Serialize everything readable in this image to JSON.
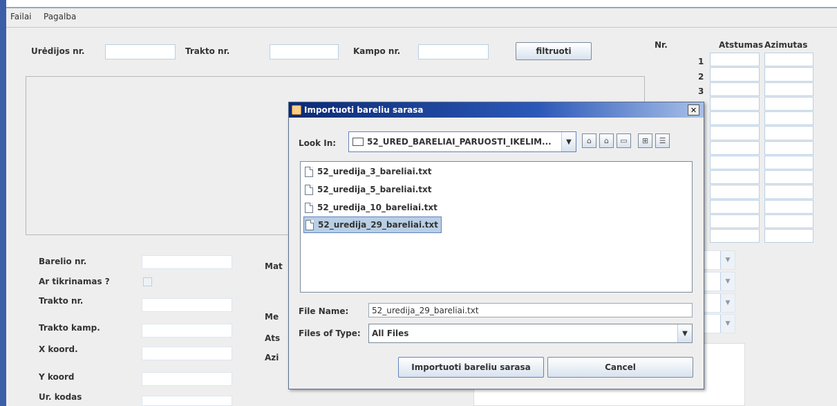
{
  "menu": {
    "items": [
      "Failai",
      "Pagalba"
    ]
  },
  "filter": {
    "uredija_label": "Urėdijos nr.",
    "trakto_label": "Trakto nr.",
    "kampo_label": "Kampo nr.",
    "button": "filtruoti"
  },
  "coords_table": {
    "nr_header": "Nr.",
    "atstumas_header": "Atstumas",
    "azimutas_header": "Azimutas",
    "row_numbers": [
      "1",
      "2",
      "3"
    ]
  },
  "form": {
    "barelio_label": "Barelio nr.",
    "tikrinamas_label": "Ar tikrinamas ?",
    "trakto_label": "Trakto nr.",
    "trakto_kamp_label": "Trakto kamp.",
    "x_label": "X koord.",
    "y_label": "Y koord",
    "ur_kodas_label": "Ur. kodas",
    "mid_label_1": "Mat",
    "mid_label_2": "Me",
    "mid_label_3": "Ats",
    "mid_label_4": "Azi"
  },
  "dialog": {
    "title": "Importuoti bareliu sarasa",
    "look_in_label": "Look In:",
    "look_in_value": "52_URED_BARELIAI_PARUOSTI_IKELIM...",
    "files": [
      "52_uredija_3_bareliai.txt",
      "52_uredija_5_bareliai.txt",
      "52_uredija_10_bareliai.txt",
      "52_uredija_29_bareliai.txt"
    ],
    "file_name_label": "File Name:",
    "file_name_value": "52_uredija_29_bareliai.txt",
    "files_of_type_label": "Files of Type:",
    "files_of_type_value": "All Files",
    "import_button": "Importuoti bareliu sarasa",
    "cancel_button": "Cancel"
  },
  "colors": {
    "accent": "#6382bf",
    "title_bar": "#1a3d8f",
    "window_bg": "#eeeeee",
    "field_border": "#b8cfe5"
  }
}
